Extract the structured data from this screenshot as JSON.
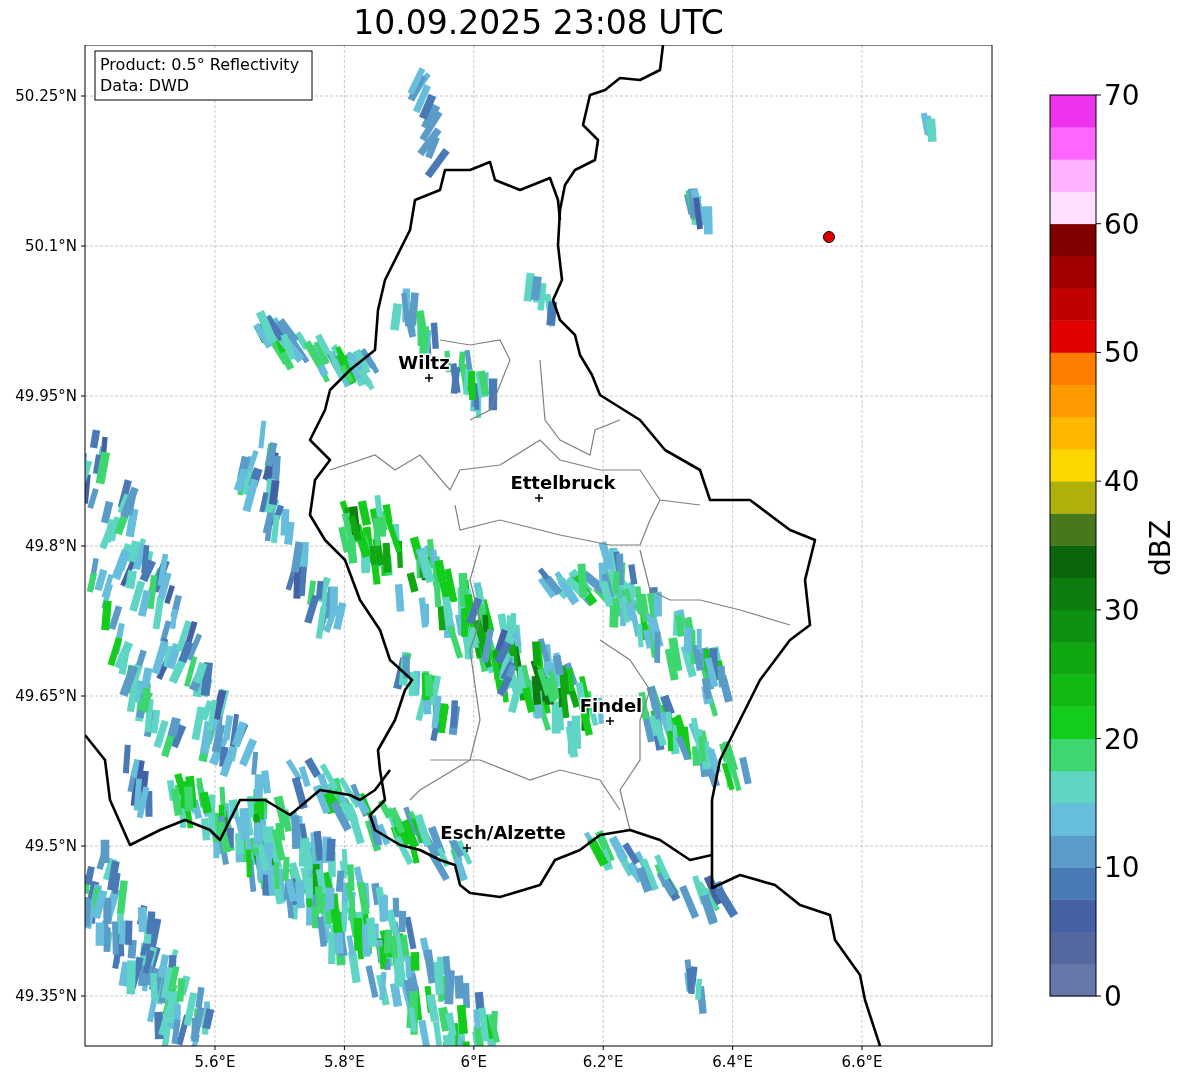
{
  "title": "10.09.2025 23:08 UTC",
  "info_box": [
    "Product: 0.5° Reflectivity",
    "Data: DWD"
  ],
  "y_ticks": [
    "50.25°N",
    "50.1°N",
    "49.95°N",
    "49.8°N",
    "49.65°N",
    "49.5°N",
    "49.35°N"
  ],
  "x_ticks": [
    "5.6°E",
    "5.8°E",
    "6°E",
    "6.2°E",
    "6.4°E",
    "6.6°E"
  ],
  "cities": [
    {
      "name": "Wiltz"
    },
    {
      "name": "Ettelbruck"
    },
    {
      "name": "Findel"
    },
    {
      "name": "Esch/Alzette"
    }
  ],
  "colorbar": {
    "label": "dBZ",
    "ticks": [
      "70",
      "60",
      "50",
      "40",
      "30",
      "20",
      "10",
      "0"
    ]
  }
}
